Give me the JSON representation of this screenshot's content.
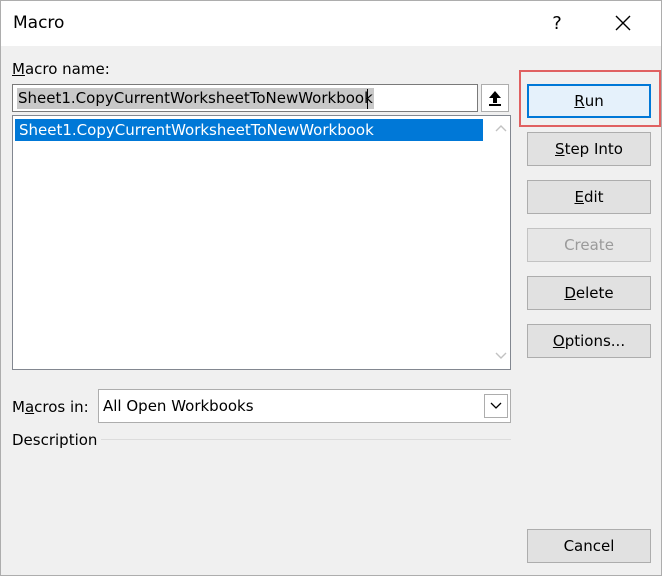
{
  "dialog": {
    "title": "Macro",
    "help_glyph": "?",
    "close_icon": "close-icon"
  },
  "macro_name": {
    "label_prefix": "",
    "label_access_key": "M",
    "label_rest": "acro name:",
    "value": "Sheet1.CopyCurrentWorksheetToNewWorkbook"
  },
  "macro_list": {
    "items": [
      "Sheet1.CopyCurrentWorksheetToNewWorkbook"
    ],
    "selected_index": 0
  },
  "macros_in": {
    "label_prefix": "M",
    "label_access_key": "a",
    "label_rest": "cros in:",
    "value": "All Open Workbooks"
  },
  "description": {
    "label": "Description"
  },
  "buttons": {
    "run": {
      "prefix": "",
      "key": "R",
      "rest": "un"
    },
    "step_into": {
      "prefix": "",
      "key": "S",
      "rest": "tep Into"
    },
    "edit": {
      "prefix": "",
      "key": "E",
      "rest": "dit"
    },
    "create": {
      "prefix": "",
      "key": "",
      "rest": "Create"
    },
    "delete": {
      "prefix": "",
      "key": "D",
      "rest": "elete"
    },
    "options": {
      "prefix": "",
      "key": "O",
      "rest": "ptions..."
    },
    "cancel": {
      "prefix": "",
      "key": "",
      "rest": "Cancel"
    }
  },
  "colors": {
    "selection": "#0078d7",
    "highlight_box": "#e06060"
  }
}
